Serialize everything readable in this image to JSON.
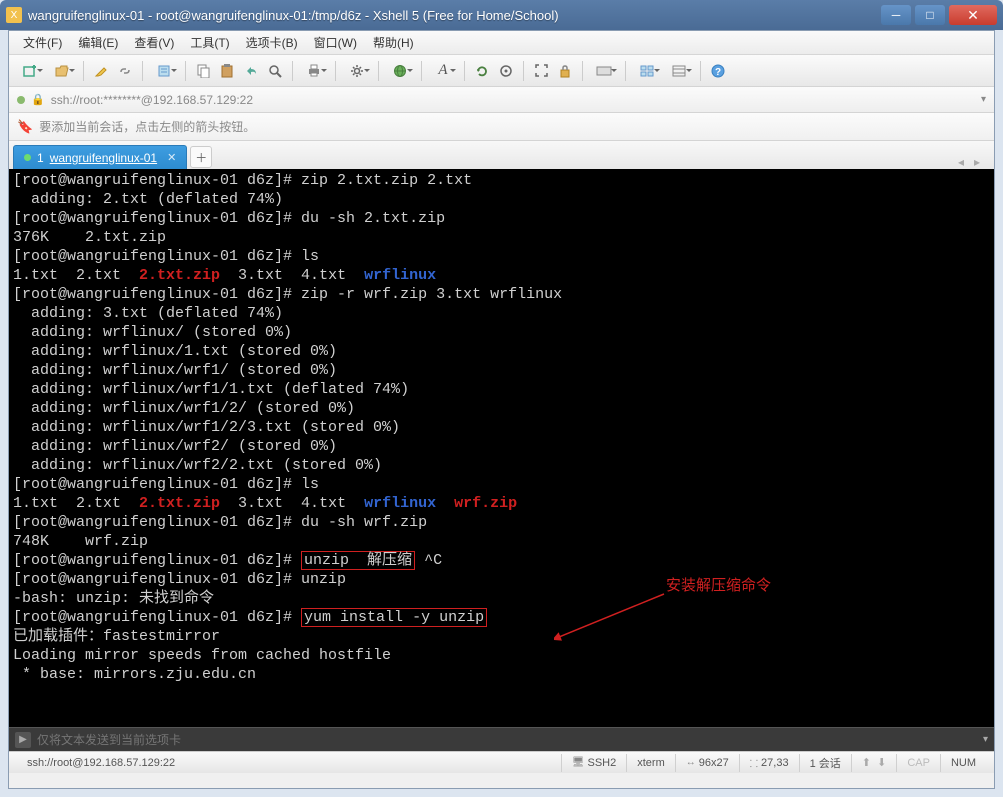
{
  "window": {
    "title": "wangruifenglinux-01 - root@wangruifenglinux-01:/tmp/d6z - Xshell 5 (Free for Home/School)"
  },
  "menus": {
    "file": "文件(F)",
    "edit": "编辑(E)",
    "view": "查看(V)",
    "tools": "工具(T)",
    "tabs": "选项卡(B)",
    "window": "窗口(W)",
    "help": "帮助(H)"
  },
  "address": {
    "url": "ssh://root:********@192.168.57.129:22"
  },
  "infobar": {
    "text": "要添加当前会话，点击左侧的箭头按钮。"
  },
  "tab": {
    "index": "1",
    "name": "wangruifenglinux-01"
  },
  "terminal": {
    "lines": [
      {
        "prompt": "[root@wangruifenglinux-01 d6z]# ",
        "cmd": "zip 2.txt.zip 2.txt"
      },
      {
        "out": "  adding: 2.txt (deflated 74%)"
      },
      {
        "prompt": "[root@wangruifenglinux-01 d6z]# ",
        "cmd": "du -sh 2.txt.zip"
      },
      {
        "out": "376K    2.txt.zip"
      },
      {
        "prompt": "[root@wangruifenglinux-01 d6z]# ",
        "cmd": "ls"
      },
      {
        "ls1": {
          "plain1": "1.txt  2.txt  ",
          "red": "2.txt.zip",
          "plain2": "  3.txt  4.txt  ",
          "blue": "wrflinux"
        }
      },
      {
        "prompt": "[root@wangruifenglinux-01 d6z]# ",
        "cmd": "zip -r wrf.zip 3.txt wrflinux"
      },
      {
        "out": "  adding: 3.txt (deflated 74%)"
      },
      {
        "out": "  adding: wrflinux/ (stored 0%)"
      },
      {
        "out": "  adding: wrflinux/1.txt (stored 0%)"
      },
      {
        "out": "  adding: wrflinux/wrf1/ (stored 0%)"
      },
      {
        "out": "  adding: wrflinux/wrf1/1.txt (deflated 74%)"
      },
      {
        "out": "  adding: wrflinux/wrf1/2/ (stored 0%)"
      },
      {
        "out": "  adding: wrflinux/wrf1/2/3.txt (stored 0%)"
      },
      {
        "out": "  adding: wrflinux/wrf2/ (stored 0%)"
      },
      {
        "out": "  adding: wrflinux/wrf2/2.txt (stored 0%)"
      },
      {
        "prompt": "[root@wangruifenglinux-01 d6z]# ",
        "cmd": "ls"
      },
      {
        "ls2": {
          "plain1": "1.txt  2.txt  ",
          "red1": "2.txt.zip",
          "plain2": "  3.txt  4.txt  ",
          "blue": "wrflinux",
          "plain3": "  ",
          "red2": "wrf.zip"
        }
      },
      {
        "prompt": "[root@wangruifenglinux-01 d6z]# ",
        "cmd": "du -sh wrf.zip"
      },
      {
        "out": "748K    wrf.zip"
      },
      {
        "prompt": "[root@wangruifenglinux-01 d6z]# ",
        "boxed": "unzip  解压缩",
        "tail": " ^C"
      },
      {
        "prompt": "[root@wangruifenglinux-01 d6z]# ",
        "cmd": "unzip"
      },
      {
        "out": "-bash: unzip: 未找到命令"
      },
      {
        "prompt": "[root@wangruifenglinux-01 d6z]# ",
        "boxed": "yum install -y unzip"
      },
      {
        "out": "已加载插件：fastestmirror"
      },
      {
        "out": "Loading mirror speeds from cached hostfile"
      },
      {
        "out": " * base: mirrors.zju.edu.cn"
      }
    ],
    "annotation": "安装解压缩命令"
  },
  "sendbar": {
    "placeholder": "仅将文本发送到当前选项卡"
  },
  "status": {
    "left": "ssh://root@192.168.57.129:22",
    "ssh": "SSH2",
    "term": "xterm",
    "size": "96x27",
    "pos": "27,33",
    "sessions": "1 会话",
    "cap": "CAP",
    "num": "NUM"
  },
  "icons": {
    "new": "＋",
    "open": "📁",
    "wand": "✎",
    "link": "🔗",
    "copy": "📋",
    "paste": "📄",
    "back": "↶",
    "search": "🔍",
    "print": "🖨",
    "settings": "⚙",
    "globe": "🌐",
    "font": "A",
    "reload": "⟳",
    "target": "◎",
    "full": "⛶",
    "lock": "🔒",
    "keys": "⌨",
    "win": "▦",
    "help": "?"
  }
}
